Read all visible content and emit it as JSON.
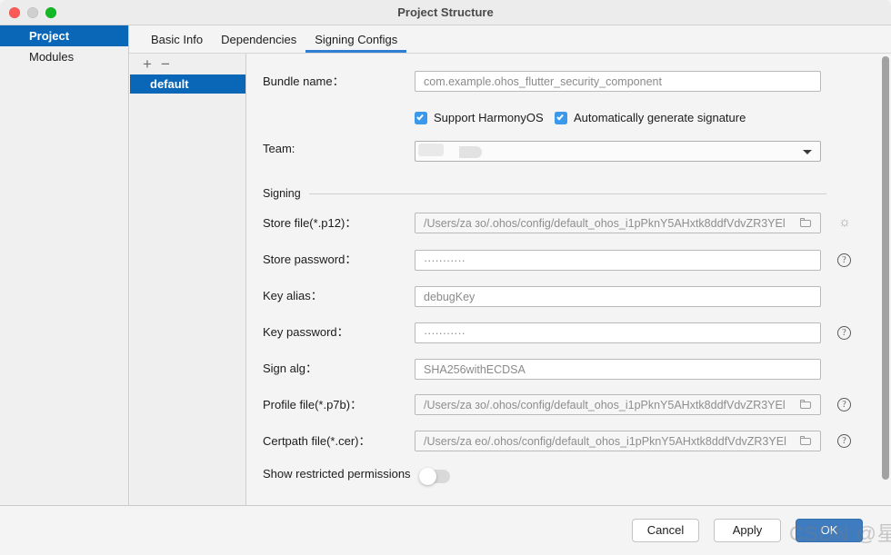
{
  "window": {
    "title": "Project Structure",
    "traffic_lights": [
      "close-red",
      "minimize-gray",
      "maximize-green"
    ]
  },
  "sidebar": {
    "items": [
      {
        "label": "Project",
        "selected": true
      },
      {
        "label": "Modules",
        "selected": false
      }
    ]
  },
  "tabs": [
    {
      "label": "Basic Info",
      "active": false
    },
    {
      "label": "Dependencies",
      "active": false
    },
    {
      "label": "Signing Configs",
      "active": true
    }
  ],
  "config_list": {
    "add_label": "+",
    "remove_label": "−",
    "items": [
      {
        "label": "default",
        "selected": true
      }
    ]
  },
  "form": {
    "bundle_name": {
      "label": "Bundle name：",
      "value": "com.example.ohos_flutter_security_component"
    },
    "checkboxes": [
      {
        "label": "Support HarmonyOS",
        "checked": true
      },
      {
        "label": "Automatically generate signature",
        "checked": true
      }
    ],
    "team": {
      "label": "Team:",
      "value": ""
    },
    "signing_group_title": "Signing",
    "store_file": {
      "label": "Store file(*.p12)：",
      "value": "/Users/za          зo/.ohos/config/default_ohos_i1pPknY5AHxtk8ddfVdvZR3YEl",
      "icon": "folder-icon",
      "side_icon": "fingerprint-icon"
    },
    "store_password": {
      "label": "Store password：",
      "value": "···········",
      "side_icon": "help-icon"
    },
    "key_alias": {
      "label": "Key alias：",
      "value": "debugKey"
    },
    "key_password": {
      "label": "Key password：",
      "value": "···········",
      "side_icon": "help-icon"
    },
    "sign_alg": {
      "label": "Sign alg：",
      "value": "SHA256withECDSA"
    },
    "profile_file": {
      "label": "Profile file(*.p7b)：",
      "value": "/Users/za          зo/.ohos/config/default_ohos_i1pPknY5AHxtk8ddfVdvZR3YEl",
      "icon": "folder-icon",
      "side_icon": "help-icon"
    },
    "certpath_file": {
      "label": "Certpath file(*.cer)：",
      "value": "/Users/za          eo/.ohos/config/default_ohos_i1pPknY5AHxtk8ddfVdvZR3YEl",
      "icon": "folder-icon",
      "side_icon": "help-icon"
    },
    "show_restricted": {
      "label": "Show restricted permissions",
      "enabled": false
    }
  },
  "footer": {
    "cancel": "Cancel",
    "apply": "Apply",
    "ok": "OK"
  },
  "watermark": {
    "text": "CSDN @星释"
  },
  "colors": {
    "accent_blue": "#0a66b7",
    "tab_underline": "#2e7fd4",
    "checkbox_blue": "#3b99ec",
    "primary_button": "#3f7cbf"
  }
}
